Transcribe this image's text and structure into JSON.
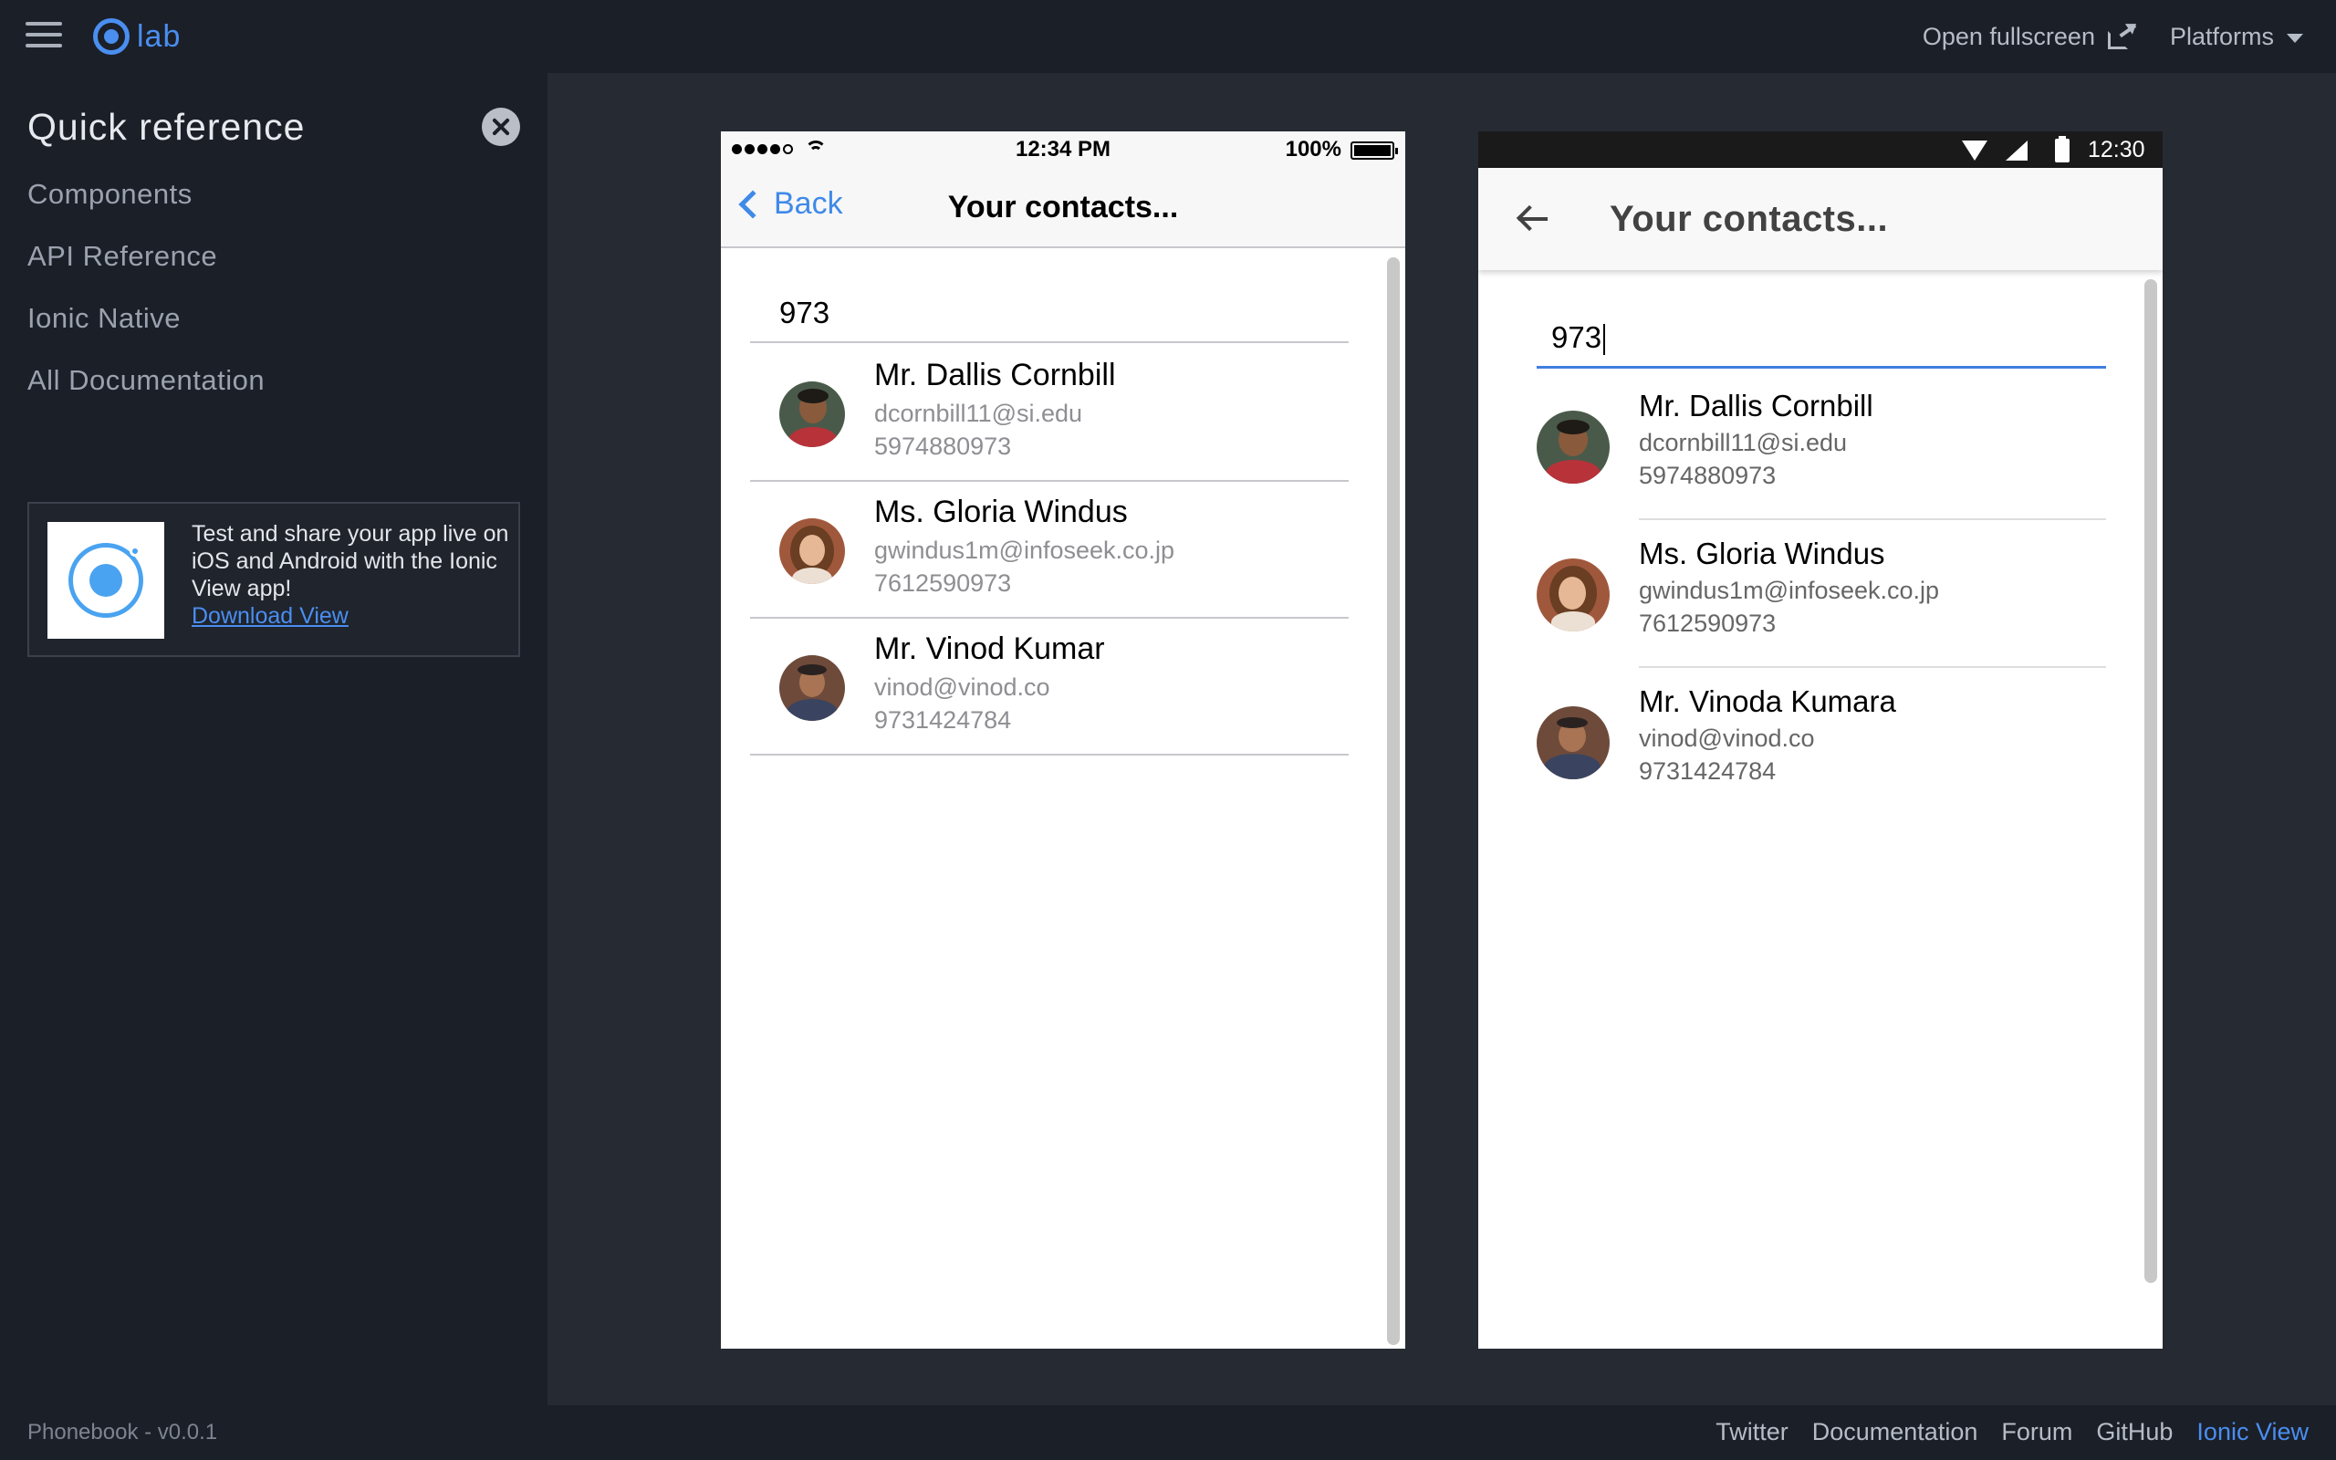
{
  "app": {
    "logo_text": "lab",
    "open_fullscreen": "Open fullscreen",
    "platforms": "Platforms"
  },
  "sidebar": {
    "title": "Quick reference",
    "links": [
      "Components",
      "API Reference",
      "Ionic Native",
      "All Documentation"
    ],
    "promo": {
      "text": "Test and share your app live on iOS and Android with the Ionic View app!",
      "link": "Download View"
    }
  },
  "footer": {
    "version": "Phonebook - v0.0.1",
    "links": [
      "Twitter",
      "Documentation",
      "Forum",
      "GitHub",
      "Ionic View"
    ]
  },
  "ios": {
    "status_time": "12:34 PM",
    "battery": "100%",
    "back_label": "Back",
    "title": "Your contacts...",
    "search_value": "973",
    "contacts": [
      {
        "name": "Mr. Dallis Cornbill",
        "email": "dcornbill11@si.edu",
        "phone": "5974880973"
      },
      {
        "name": "Ms. Gloria Windus",
        "email": "gwindus1m@infoseek.co.jp",
        "phone": "7612590973"
      },
      {
        "name": "Mr. Vinod Kumar",
        "email": "vinod@vinod.co",
        "phone": "9731424784"
      }
    ]
  },
  "android": {
    "status_time": "12:30",
    "title": "Your contacts...",
    "search_value": "973",
    "contacts": [
      {
        "name": "Mr. Dallis Cornbill",
        "email": "dcornbill11@si.edu",
        "phone": "5974880973"
      },
      {
        "name": "Ms. Gloria Windus",
        "email": "gwindus1m@infoseek.co.jp",
        "phone": "7612590973"
      },
      {
        "name": "Mr. Vinoda Kumara",
        "email": "vinod@vinod.co",
        "phone": "9731424784"
      }
    ]
  },
  "colors": {
    "accent": "#4a8ef0",
    "ios_blue": "#3f8ae8",
    "android_underline": "#3f7ee0"
  }
}
